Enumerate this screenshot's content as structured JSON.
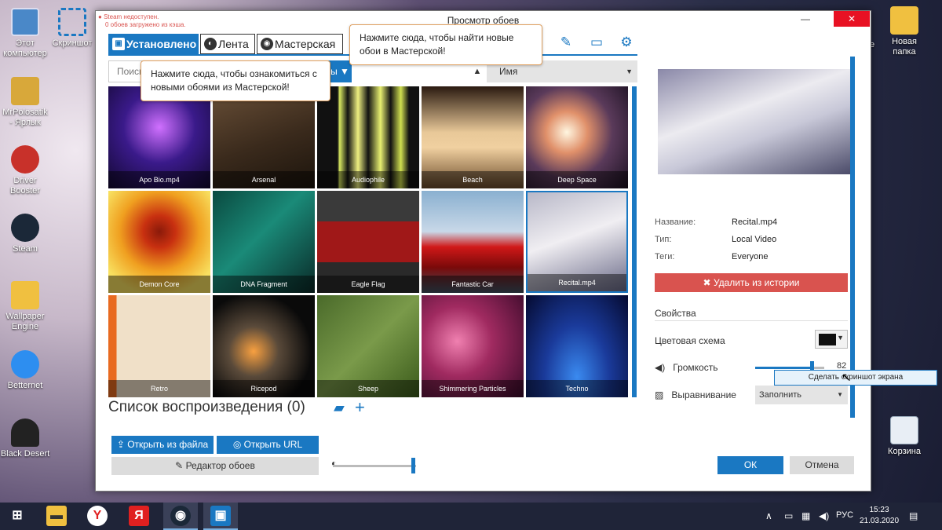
{
  "desktop": {
    "icons": [
      {
        "label": "Этот компьютер",
        "icon": "computer-icon"
      },
      {
        "label": "Скриншот",
        "icon": "screenshot-icon"
      },
      {
        "label": "MrPolosatik - Ярлык",
        "icon": "user-shortcut-icon"
      },
      {
        "label": "Driver Booster",
        "icon": "driver-booster-icon"
      },
      {
        "label": "Steam",
        "icon": "steam-icon"
      },
      {
        "label": "Wallpaper Engine",
        "icon": "folder-icon"
      },
      {
        "label": "Betternet",
        "icon": "betternet-icon"
      },
      {
        "label": "Black Desert",
        "icon": "black-desert-icon"
      },
      {
        "label": "Новая папка",
        "icon": "folder-icon"
      },
      {
        "label": "Корзина",
        "icon": "recycle-bin-icon"
      }
    ],
    "partial_label": "ие"
  },
  "window": {
    "title": "Просмотр обоев",
    "notice_line1": "Steam недоступен.",
    "notice_line2": "0 обоев загружено из кэша.",
    "tabs": [
      {
        "label": "Установлено",
        "icon": "save-icon"
      },
      {
        "label": "Лента",
        "icon": "compass-icon"
      },
      {
        "label": "Мастерская",
        "icon": "steam-icon"
      }
    ],
    "tooltip_workshop": "Нажмите сюда, чтобы найти новые обои в Мастерской!",
    "tooltip_feed": "Нажмите сюда, чтобы ознакомиться с новыми обоями из Мастерской!",
    "search_placeholder": "Поиск",
    "filter_label": "ы",
    "sort_label": "Имя",
    "wallpapers": [
      {
        "name": "Apo Bio.mp4"
      },
      {
        "name": "Arsenal"
      },
      {
        "name": "Audiophile"
      },
      {
        "name": "Beach"
      },
      {
        "name": "Deep Space"
      },
      {
        "name": "Demon Core"
      },
      {
        "name": "DNA Fragment"
      },
      {
        "name": "Eagle Flag"
      },
      {
        "name": "Fantastic Car"
      },
      {
        "name": "Recital.mp4"
      },
      {
        "name": "Retro"
      },
      {
        "name": "Ricepod"
      },
      {
        "name": "Sheep"
      },
      {
        "name": "Shimmering Particles"
      },
      {
        "name": "Techno"
      }
    ],
    "playlist_title": "Список воспроизведения (0)",
    "open_file": "Открыть из файла",
    "open_url": "Открыть URL",
    "editor": "Редактор обоев",
    "ok": "ОК",
    "cancel": "Отмена",
    "details": {
      "name_label": "Название:",
      "name_value": "Recital.mp4",
      "type_label": "Тип:",
      "type_value": "Local Video",
      "tags_label": "Теги:",
      "tags_value": "Everyone",
      "remove_button": "Удалить из истории"
    },
    "properties": {
      "title": "Свойства",
      "color_scheme": "Цветовая схема",
      "color_value": "#111111",
      "volume_label": "Громкость",
      "volume_value": "82",
      "align_label": "Выравнивание",
      "align_value": "Заполнить",
      "screenshot_tip": "Сделать скриншот экрана"
    }
  },
  "taskbar": {
    "lang": "РУС",
    "time": "15:23",
    "date": "21.03.2020"
  },
  "colors": {
    "accent": "#1a78c2",
    "danger": "#d9534f"
  }
}
